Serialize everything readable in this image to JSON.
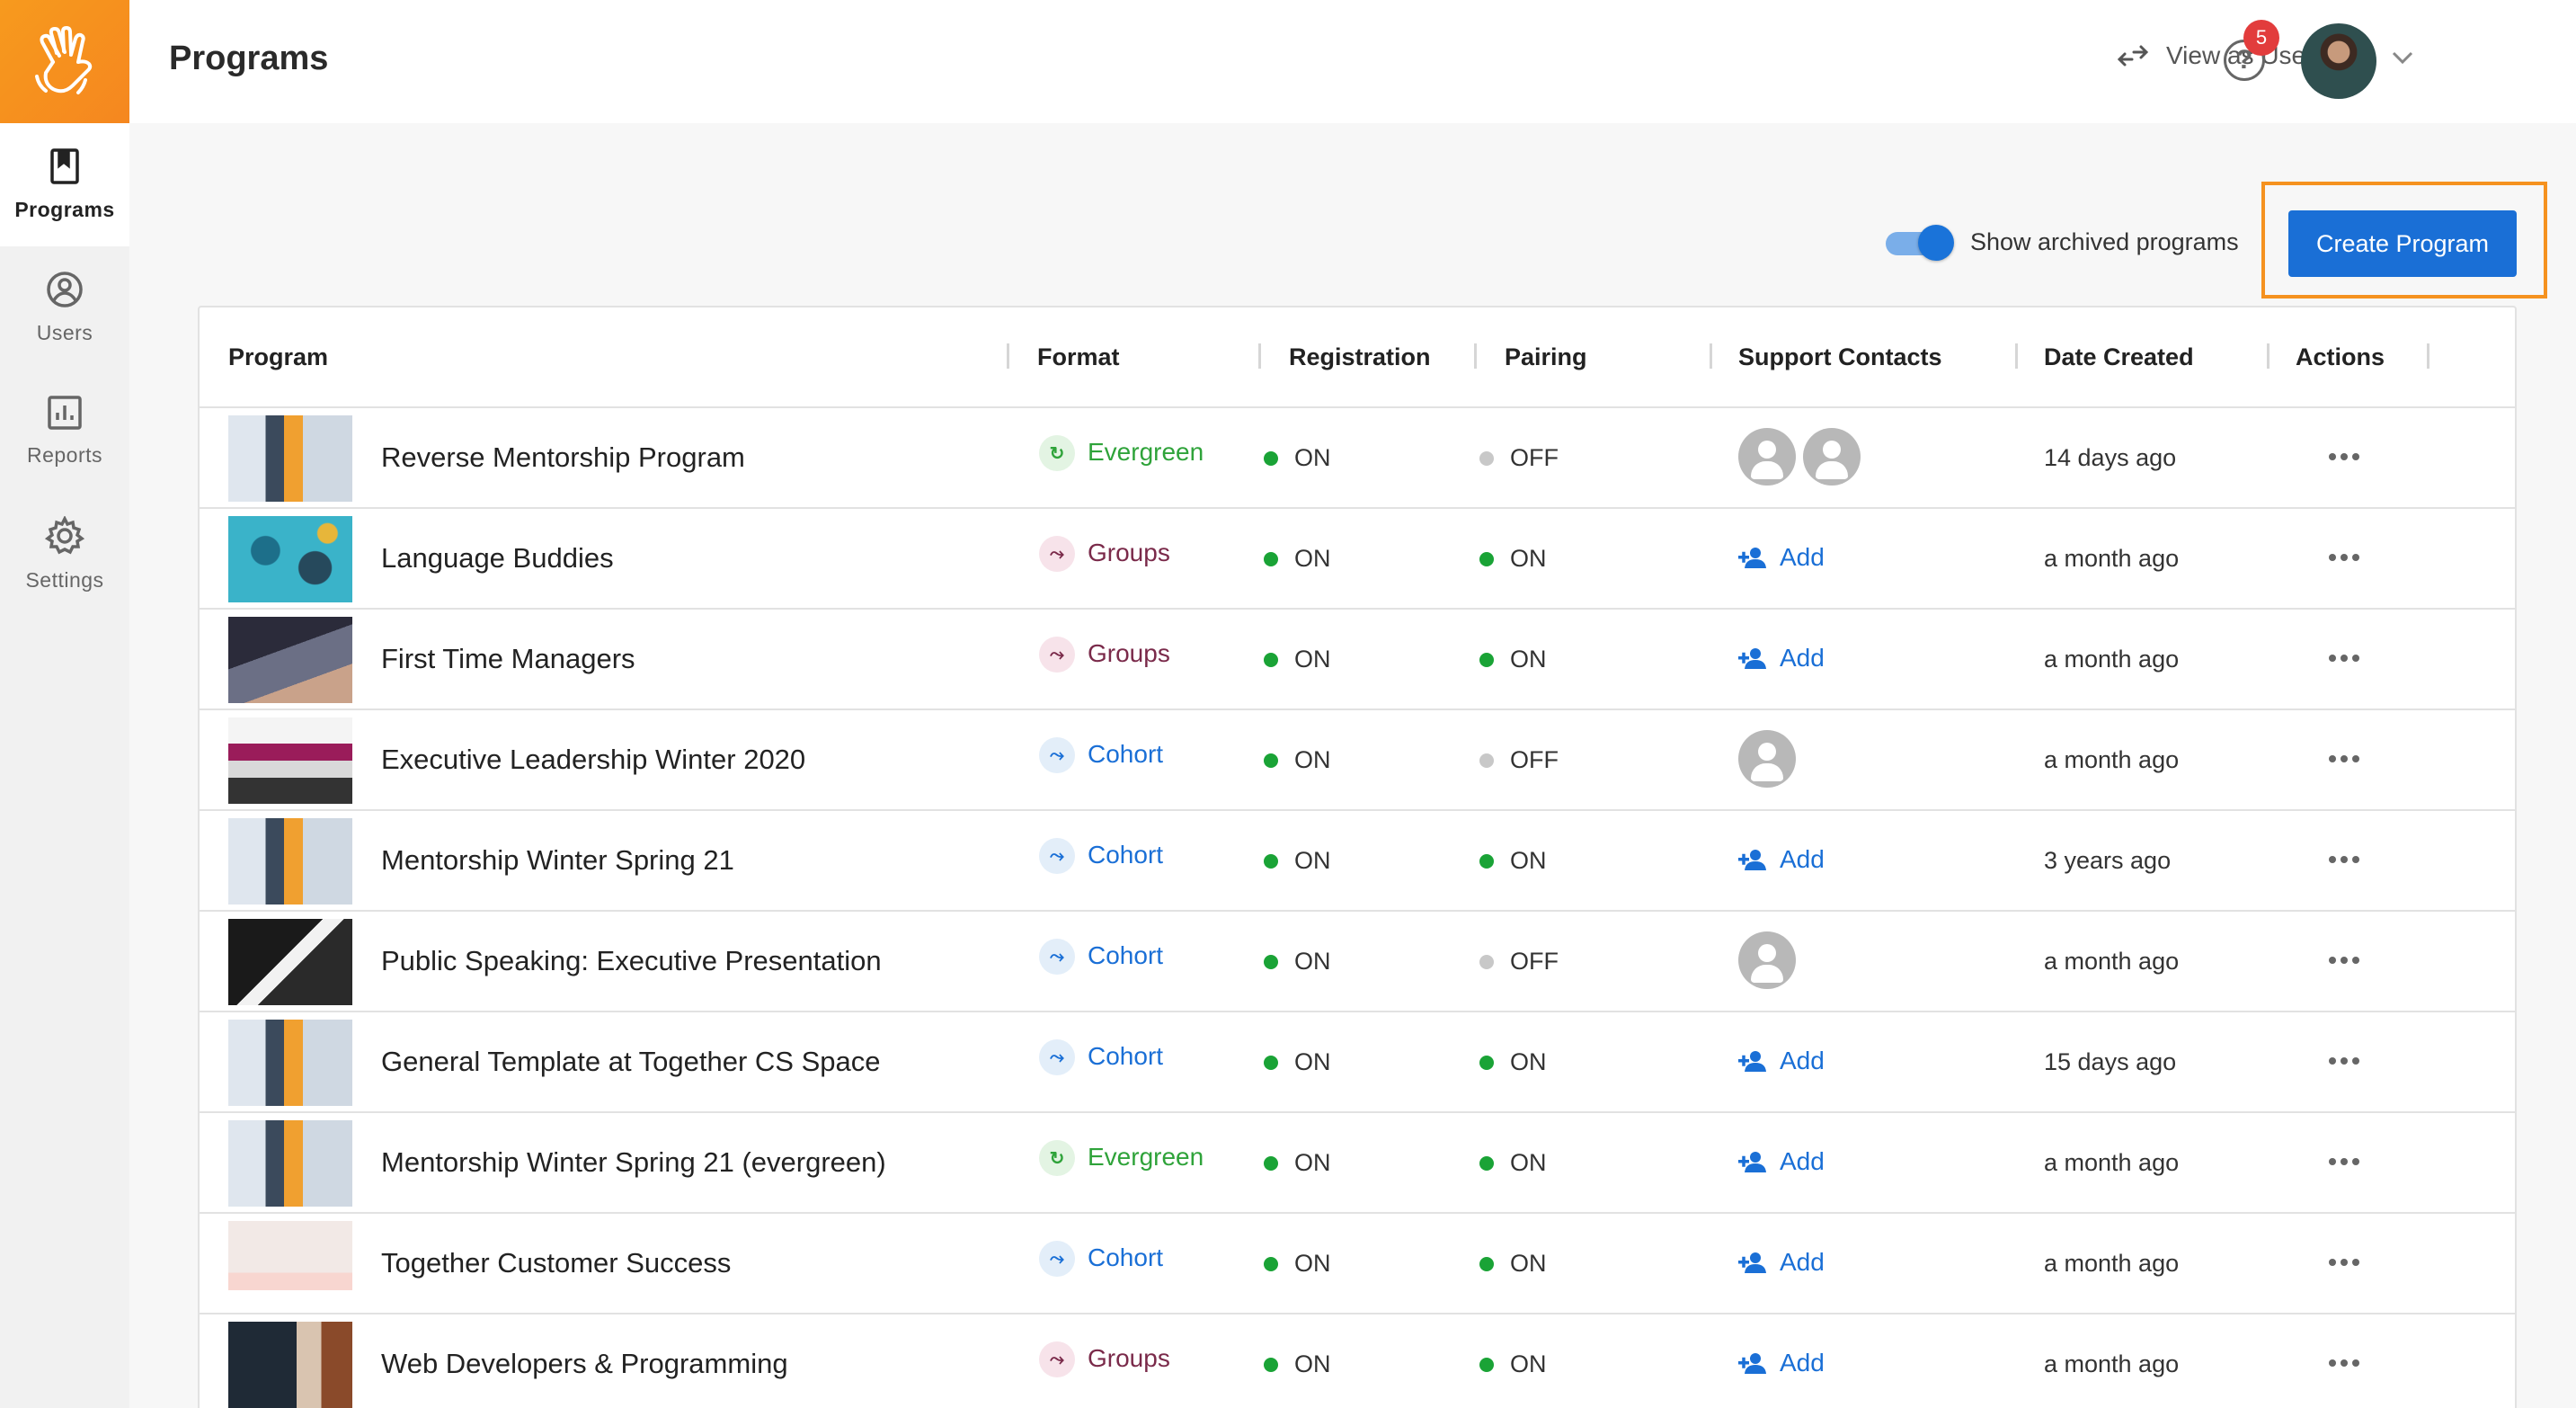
{
  "sidebar": {
    "items": [
      {
        "label": "Programs",
        "icon": "book-icon",
        "active": true
      },
      {
        "label": "Users",
        "icon": "user-circle-icon",
        "active": false
      },
      {
        "label": "Reports",
        "icon": "bar-chart-icon",
        "active": false
      },
      {
        "label": "Settings",
        "icon": "gear-icon",
        "active": false
      }
    ]
  },
  "header": {
    "title": "Programs",
    "view_as_user": "View as User",
    "notification_count": "5"
  },
  "toolbar": {
    "show_archived_label": "Show archived programs",
    "show_archived": true,
    "create_label": "Create Program"
  },
  "table": {
    "columns": [
      "Program",
      "Format",
      "Registration",
      "Pairing",
      "Support Contacts",
      "Date Created",
      "Actions"
    ],
    "rows": [
      {
        "name": "Reverse Mentorship Program",
        "format": "Evergreen",
        "registration": "ON",
        "pairing": "OFF",
        "contacts": 2,
        "date": "14 days ago"
      },
      {
        "name": "Language Buddies",
        "format": "Groups",
        "registration": "ON",
        "pairing": "ON",
        "contacts": 0,
        "date": "a month ago"
      },
      {
        "name": "First Time Managers",
        "format": "Groups",
        "registration": "ON",
        "pairing": "ON",
        "contacts": 0,
        "date": "a month ago"
      },
      {
        "name": "Executive Leadership Winter 2020",
        "format": "Cohort",
        "registration": "ON",
        "pairing": "OFF",
        "contacts": 1,
        "date": "a month ago"
      },
      {
        "name": "Mentorship Winter Spring 21",
        "format": "Cohort",
        "registration": "ON",
        "pairing": "ON",
        "contacts": 0,
        "date": "3 years ago"
      },
      {
        "name": "Public Speaking: Executive Presentation",
        "format": "Cohort",
        "registration": "ON",
        "pairing": "OFF",
        "contacts": 1,
        "date": "a month ago"
      },
      {
        "name": "General Template at Together CS Space",
        "format": "Cohort",
        "registration": "ON",
        "pairing": "ON",
        "contacts": 0,
        "date": "15 days ago"
      },
      {
        "name": "Mentorship Winter Spring 21 (evergreen)",
        "format": "Evergreen",
        "registration": "ON",
        "pairing": "ON",
        "contacts": 0,
        "date": "a month ago"
      },
      {
        "name": "Together Customer Success",
        "format": "Cohort",
        "registration": "ON",
        "pairing": "ON",
        "contacts": 0,
        "date": "a month ago"
      },
      {
        "name": "Web Developers & Programming",
        "format": "Groups",
        "registration": "ON",
        "pairing": "ON",
        "contacts": 0,
        "date": "a month ago"
      }
    ],
    "add_label": "Add"
  },
  "colors": {
    "brand": "#f5871f",
    "primary": "#1a6fd6",
    "evergreen": "#2fa33a",
    "groups": "#7a2a4a",
    "cohort": "#1a6fd6",
    "status_on": "#1aa336",
    "status_off": "#c8c8c8",
    "badge": "#e23c3c"
  }
}
